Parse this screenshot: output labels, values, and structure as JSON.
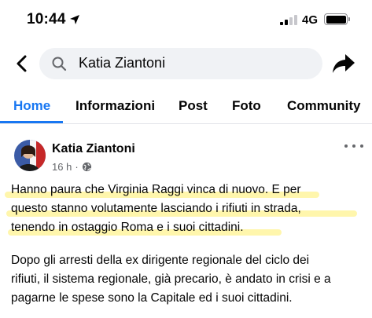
{
  "status_bar": {
    "time": "10:44",
    "network": "4G"
  },
  "search": {
    "query": "Katia Ziantoni"
  },
  "tabs": [
    {
      "label": "Home",
      "active": true
    },
    {
      "label": "Informazioni",
      "active": false
    },
    {
      "label": "Post",
      "active": false
    },
    {
      "label": "Foto",
      "active": false
    },
    {
      "label": "Community",
      "active": false
    }
  ],
  "post": {
    "author": "Katia Ziantoni",
    "time": "16 h",
    "paragraph1_lines": [
      "Hanno paura che Virginia Raggi vinca di nuovo. E per",
      "questo stanno volutamente lasciando i rifiuti in strada,",
      "tenendo in ostaggio Roma e i suoi cittadini."
    ],
    "paragraph2_lines": [
      "Dopo gli arresti della ex dirigente regionale del ciclo dei",
      "rifiuti, il sistema regionale, già precario, è andato in crisi e a",
      "pagarne le spese sono la Capitale ed i suoi cittadini."
    ]
  },
  "colors": {
    "accent": "#1877f2",
    "highlight": "#fff59d",
    "secondary_text": "#65676b"
  },
  "icons": [
    "location-arrow-icon",
    "signal-icon",
    "battery-icon",
    "back-arrow-icon",
    "search-icon",
    "share-icon",
    "globe-icon",
    "more-options-icon"
  ]
}
